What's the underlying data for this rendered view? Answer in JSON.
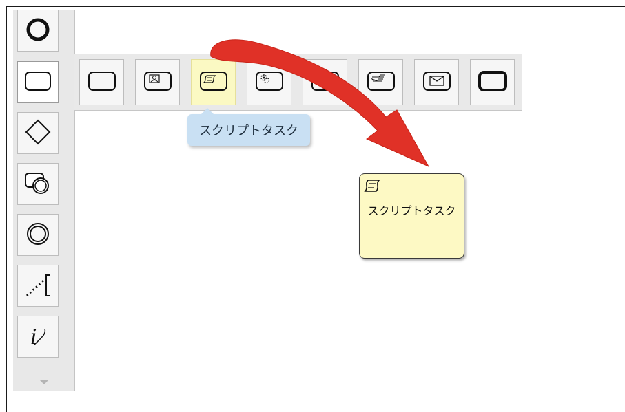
{
  "tooltip": {
    "text": "スクリプトタスク"
  },
  "canvas_task": {
    "label": "スクリプトタスク"
  },
  "palette": {
    "items": [
      {
        "icon": "start-event-icon"
      },
      {
        "icon": "task-icon"
      },
      {
        "icon": "gateway-icon"
      },
      {
        "icon": "subprocess-icon"
      },
      {
        "icon": "intermediate-event-icon"
      },
      {
        "icon": "annotation-icon"
      },
      {
        "icon": "data-object-icon"
      }
    ],
    "more_icon": "chevron-down-icon"
  },
  "task_types": [
    {
      "icon": "plain-task-icon"
    },
    {
      "icon": "user-task-icon"
    },
    {
      "icon": "script-task-icon"
    },
    {
      "icon": "service-task-icon"
    },
    {
      "icon": "task-icon"
    },
    {
      "icon": "manual-task-icon"
    },
    {
      "icon": "message-task-icon"
    },
    {
      "icon": "call-activity-icon"
    }
  ],
  "colors": {
    "highlight": "#fbf9c3",
    "tooltip": "#c9e0f3",
    "task_fill": "#fdf9c4",
    "arrow": "#e03127"
  }
}
